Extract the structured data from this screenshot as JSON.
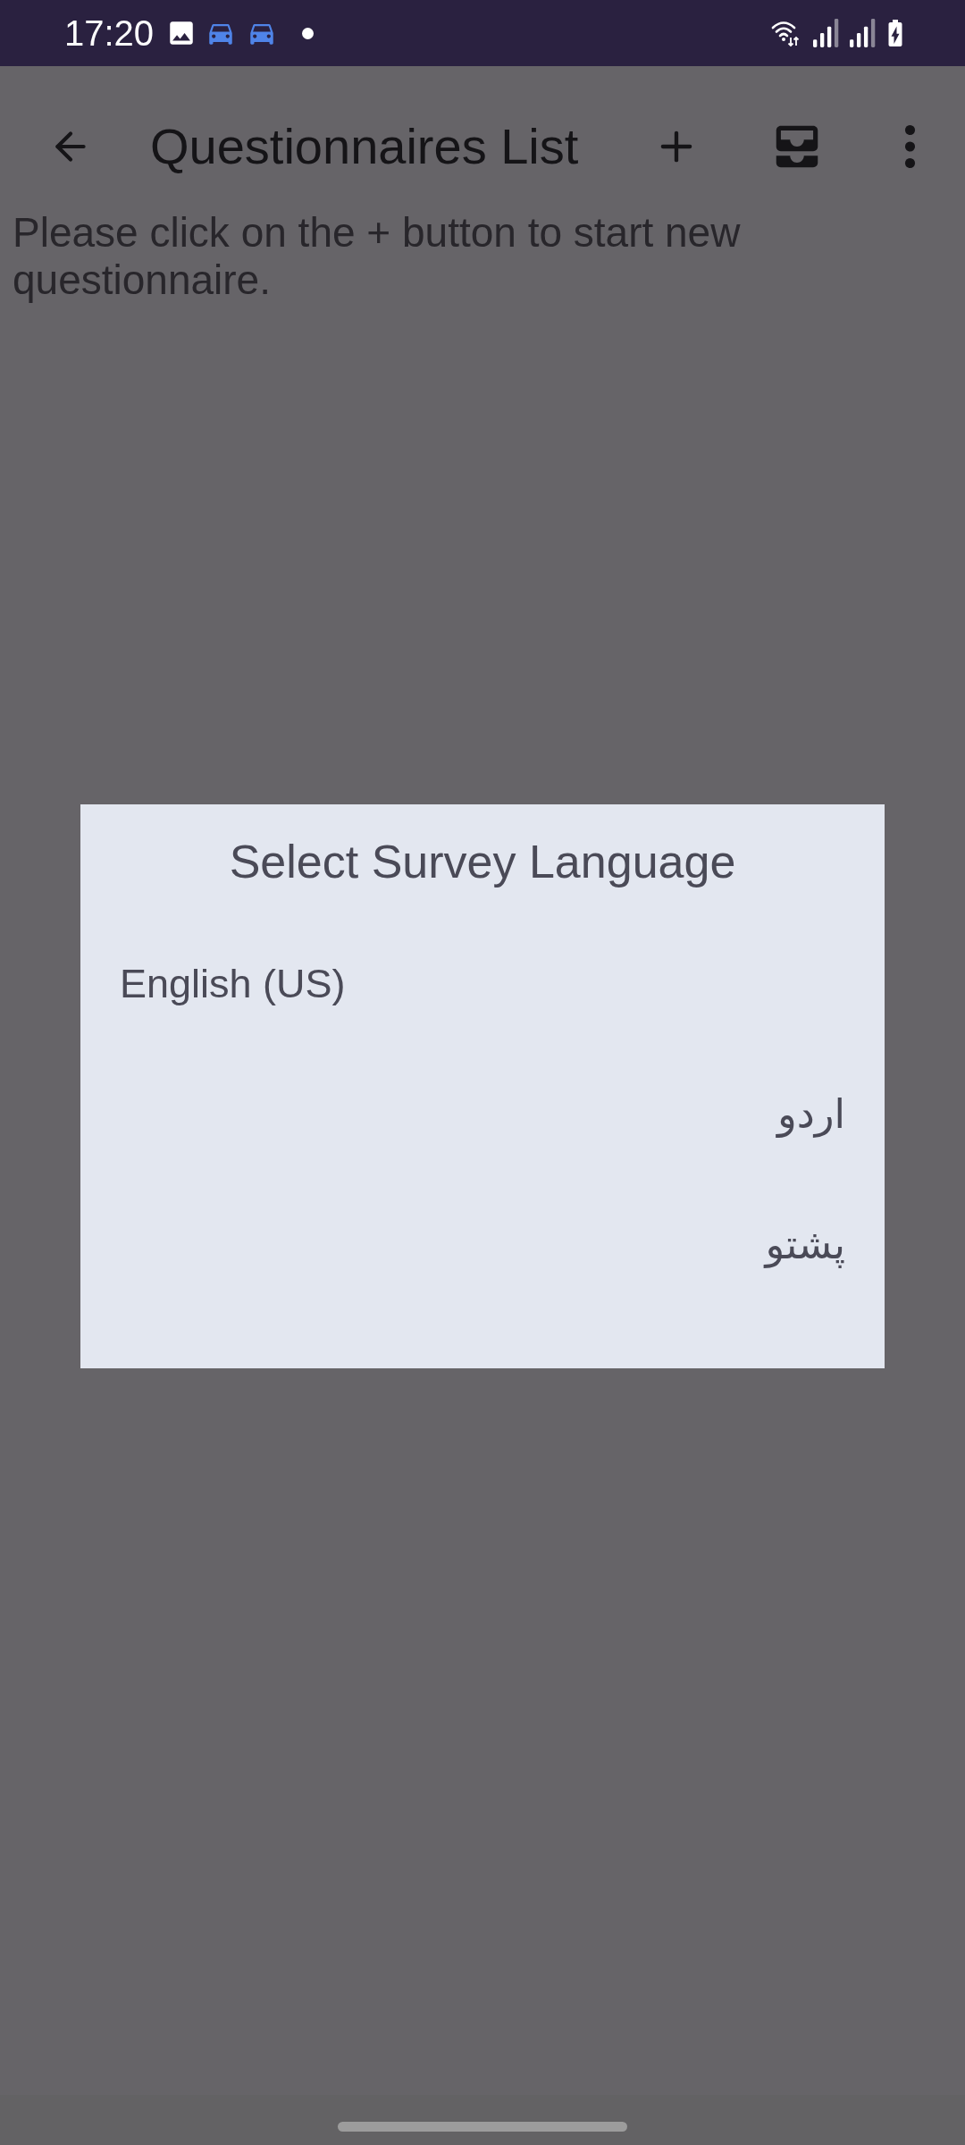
{
  "status_bar": {
    "time": "17:20"
  },
  "app_bar": {
    "title": "Questionnaires List"
  },
  "message": "Please click on the + button to start new questionnaire.",
  "dialog": {
    "title": "Select Survey Language",
    "options": [
      "English (US)",
      "اردو",
      "پشتو"
    ]
  }
}
